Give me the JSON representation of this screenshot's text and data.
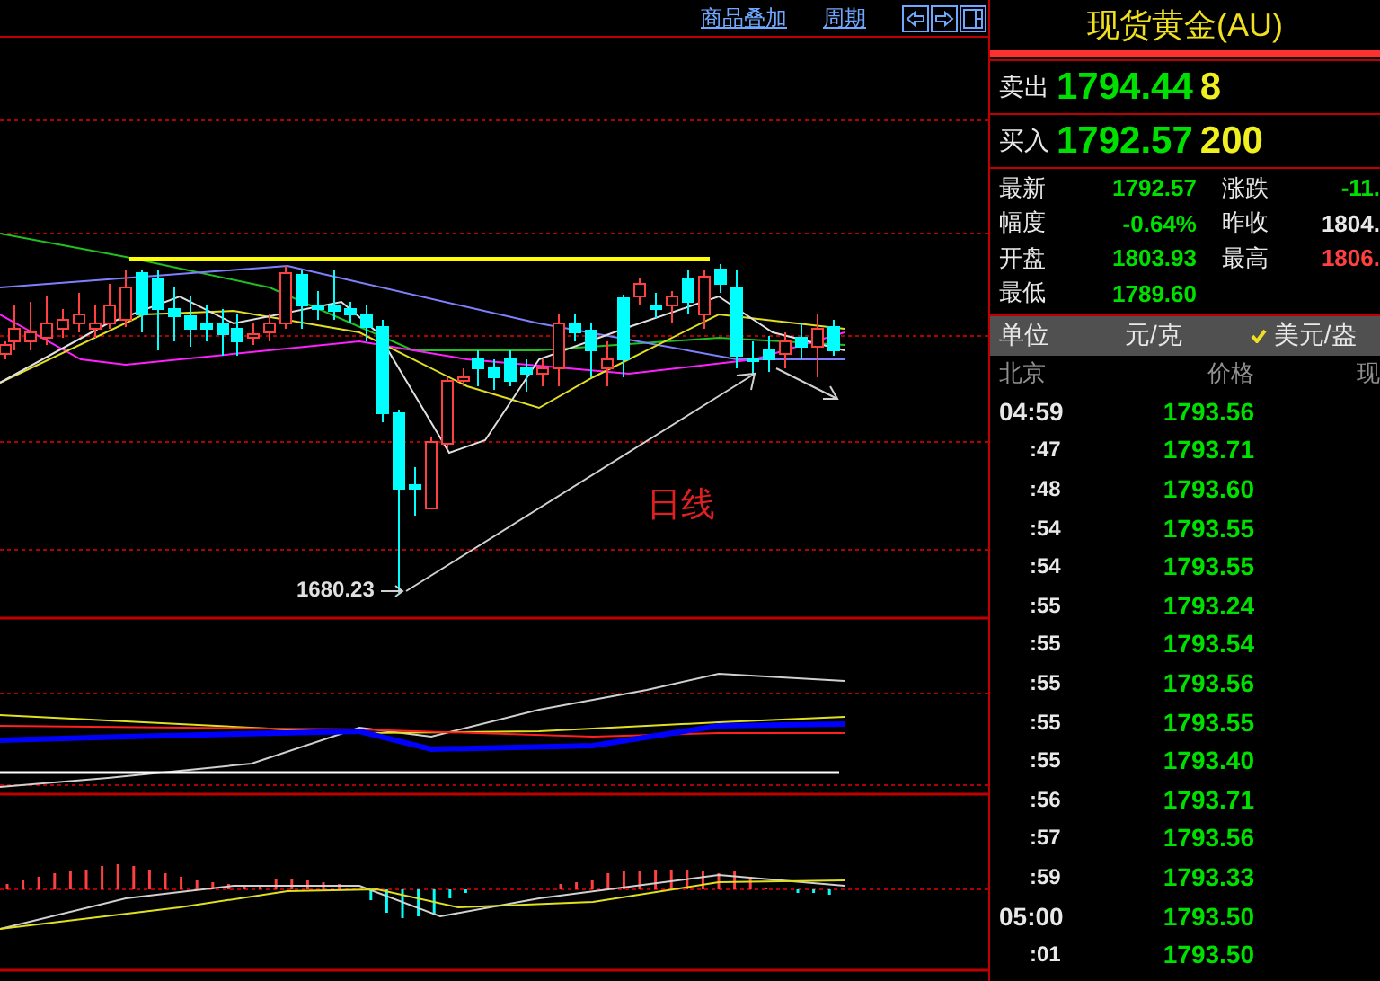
{
  "toolbar": {
    "links": [
      "商品叠加",
      "周期"
    ]
  },
  "chart": {
    "low_label": "1680.23",
    "period_label": "日线"
  },
  "quote": {
    "title": "现货黄金(AU)",
    "sides": [
      {
        "label": "卖出",
        "price": "1794.44",
        "volume": "8"
      },
      {
        "label": "买入",
        "price": "1792.57",
        "volume": "200"
      }
    ]
  },
  "stats": [
    {
      "label": "最新",
      "value": "1792.57",
      "color": "#00e000"
    },
    {
      "label": "涨跌",
      "value": "-11.",
      "color": "#00e000"
    },
    {
      "label": "幅度",
      "value": "-0.64%",
      "color": "#00e000"
    },
    {
      "label": "昨收",
      "value": "1804.",
      "color": "#e8e8e8"
    },
    {
      "label": "开盘",
      "value": "1803.93",
      "color": "#00e000"
    },
    {
      "label": "最高",
      "value": "1806.",
      "color": "#ff4040"
    },
    {
      "label": "最低",
      "value": "1789.60",
      "color": "#00e000"
    }
  ],
  "units": {
    "label": "单位",
    "options": [
      {
        "label": "元/克",
        "selected": false
      },
      {
        "label": "美元/盎",
        "selected": true
      }
    ]
  },
  "ticks": {
    "columns": [
      "北京",
      "价格",
      "现"
    ],
    "rows": [
      {
        "time": "04:59",
        "kind": "hour",
        "price": "1793.56"
      },
      {
        "time": ":47",
        "kind": "minute",
        "price": "1793.71"
      },
      {
        "time": ":48",
        "kind": "minute",
        "price": "1793.60"
      },
      {
        "time": ":54",
        "kind": "minute",
        "price": "1793.55"
      },
      {
        "time": ":54",
        "kind": "minute",
        "price": "1793.55"
      },
      {
        "time": ":55",
        "kind": "minute",
        "price": "1793.24"
      },
      {
        "time": ":55",
        "kind": "minute",
        "price": "1793.54"
      },
      {
        "time": ":55",
        "kind": "minute",
        "price": "1793.56"
      },
      {
        "time": ":55",
        "kind": "minute",
        "price": "1793.55"
      },
      {
        "time": ":55",
        "kind": "minute",
        "price": "1793.40"
      },
      {
        "time": ":56",
        "kind": "minute",
        "price": "1793.71"
      },
      {
        "time": ":57",
        "kind": "minute",
        "price": "1793.56"
      },
      {
        "time": ":59",
        "kind": "minute",
        "price": "1793.33"
      },
      {
        "time": "05:00",
        "kind": "hour",
        "price": "1793.50"
      },
      {
        "time": ":01",
        "kind": "minute",
        "price": "1793.50"
      }
    ]
  }
}
